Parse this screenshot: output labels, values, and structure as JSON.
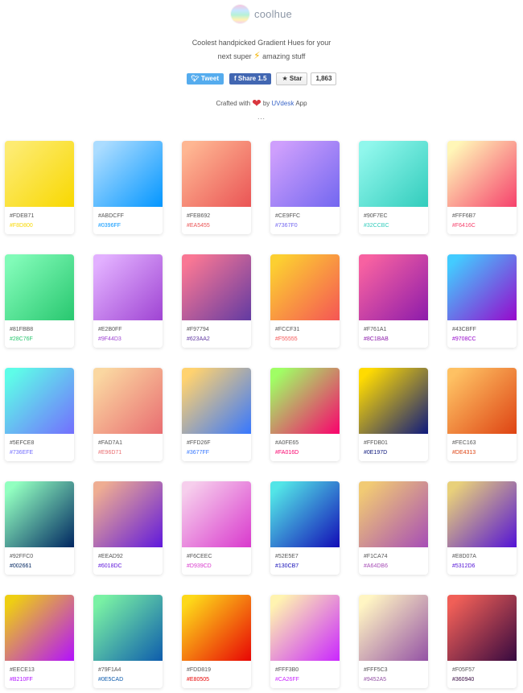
{
  "header": {
    "brand": "coolhue",
    "tagline_line1": "Coolest handpicked Gradient Hues for your",
    "tagline_line2_before": "next super",
    "bolt_icon": "⚡",
    "tagline_line2_after": "amazing stuff",
    "tweet_label": "Tweet",
    "share_label": "Share 1.5",
    "star_label": "★ Star",
    "star_count": "1,863",
    "crafted_before": "Crafted with",
    "crafted_by": "by",
    "uvdesk": "UVdesk",
    "crafted_after": "App",
    "dots": "..."
  },
  "gradients": [
    {
      "from": "#FDEB71",
      "to": "#F8D800"
    },
    {
      "from": "#ABDCFF",
      "to": "#0396FF"
    },
    {
      "from": "#FEB692",
      "to": "#EA5455"
    },
    {
      "from": "#CE9FFC",
      "to": "#7367F0"
    },
    {
      "from": "#90F7EC",
      "to": "#32CCBC"
    },
    {
      "from": "#FFF6B7",
      "to": "#F6416C"
    },
    {
      "from": "#81FBB8",
      "to": "#28C76F"
    },
    {
      "from": "#E2B0FF",
      "to": "#9F44D3"
    },
    {
      "from": "#F97794",
      "to": "#623AA2"
    },
    {
      "from": "#FCCF31",
      "to": "#F55555"
    },
    {
      "from": "#F761A1",
      "to": "#8C1BAB"
    },
    {
      "from": "#43CBFF",
      "to": "#9708CC"
    },
    {
      "from": "#5EFCE8",
      "to": "#736EFE"
    },
    {
      "from": "#FAD7A1",
      "to": "#E96D71"
    },
    {
      "from": "#FFD26F",
      "to": "#3677FF"
    },
    {
      "from": "#A0FE65",
      "to": "#FA016D"
    },
    {
      "from": "#FFDB01",
      "to": "#0E197D"
    },
    {
      "from": "#FEC163",
      "to": "#DE4313"
    },
    {
      "from": "#92FFC0",
      "to": "#002661"
    },
    {
      "from": "#EEAD92",
      "to": "#6018DC"
    },
    {
      "from": "#F6CEEC",
      "to": "#D939CD"
    },
    {
      "from": "#52E5E7",
      "to": "#130CB7"
    },
    {
      "from": "#F1CA74",
      "to": "#A64DB6"
    },
    {
      "from": "#E8D07A",
      "to": "#5312D6"
    },
    {
      "from": "#EECE13",
      "to": "#B210FF"
    },
    {
      "from": "#79F1A4",
      "to": "#0E5CAD"
    },
    {
      "from": "#FDD819",
      "to": "#E80505"
    },
    {
      "from": "#FFF3B0",
      "to": "#CA26FF"
    },
    {
      "from": "#FFF5C3",
      "to": "#9452A5"
    },
    {
      "from": "#F05F57",
      "to": "#360940"
    }
  ]
}
